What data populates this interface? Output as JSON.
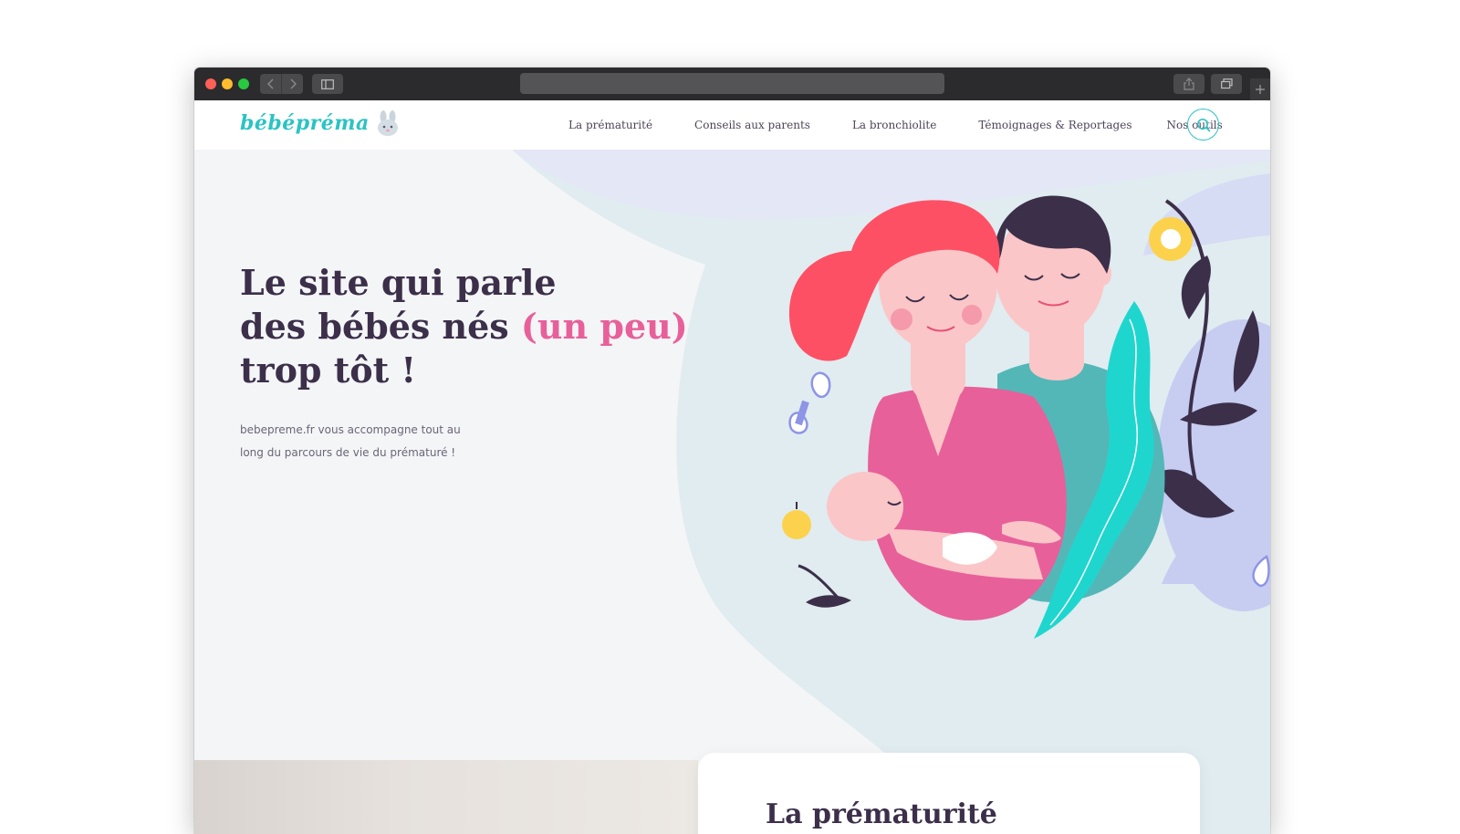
{
  "brand": {
    "name": "bébépréma",
    "primary_color": "#2bc3c4",
    "text_color": "#3c2f4a",
    "accent_pink": "#e8609a"
  },
  "nav": {
    "items": [
      {
        "label": "La prématurité"
      },
      {
        "label": "Conseils aux parents"
      },
      {
        "label": "La bronchiolite"
      },
      {
        "label": "Témoignages & Reportages"
      },
      {
        "label": "Nos outils"
      }
    ],
    "search_icon": "search-icon"
  },
  "hero": {
    "title_line1": "Le site qui parle",
    "title_line2": "des bébés nés",
    "title_highlight": "(un peu)",
    "title_line3": "trop tôt !",
    "subtitle_line1": "bebepreme.fr vous accompagne tout au",
    "subtitle_line2": "long du parcours de vie du prématuré !",
    "illustration": "parents-holding-baby-illustration"
  },
  "section": {
    "card_title": "La prématurité"
  }
}
